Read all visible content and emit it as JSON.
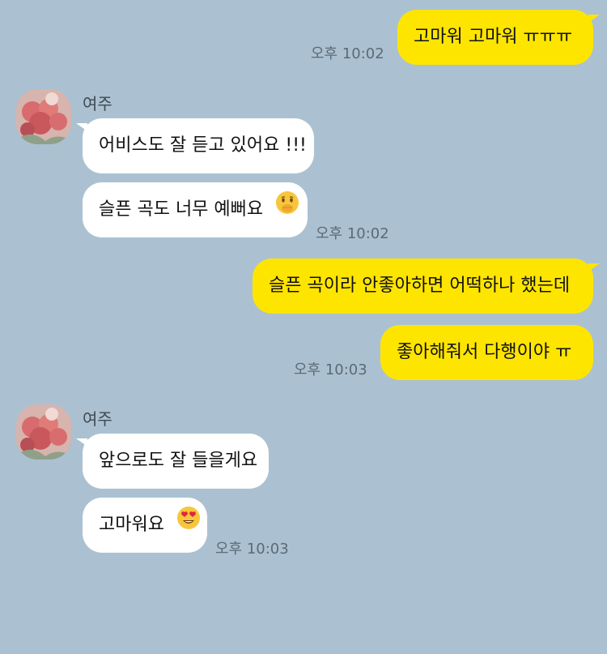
{
  "messages": {
    "m1": {
      "text": "고마워 고마워 ㅠㅠㅠ",
      "time": "오후 10:02"
    },
    "sender": "여주",
    "m2": {
      "text": "어비스도 잘 듣고 있어요 !!!"
    },
    "m3": {
      "text": "슬픈 곡도 너무 예뻐요",
      "emoji": "hand-over-mouth-emoji",
      "time": "오후 10:02"
    },
    "m4": {
      "text": "슬픈 곡이라 안좋아하면 어떡하나 했는데"
    },
    "m5": {
      "text": "좋아해줘서 다행이야 ㅠ",
      "time": "오후 10:03"
    },
    "m6": {
      "text": "앞으로도 잘 들을게요"
    },
    "m7": {
      "text": "고마워요",
      "emoji": "heart-eyes-emoji",
      "time": "오후 10:03"
    }
  },
  "colors": {
    "background": "#abc1d1",
    "my_bubble": "#fee500",
    "their_bubble": "#ffffff"
  }
}
